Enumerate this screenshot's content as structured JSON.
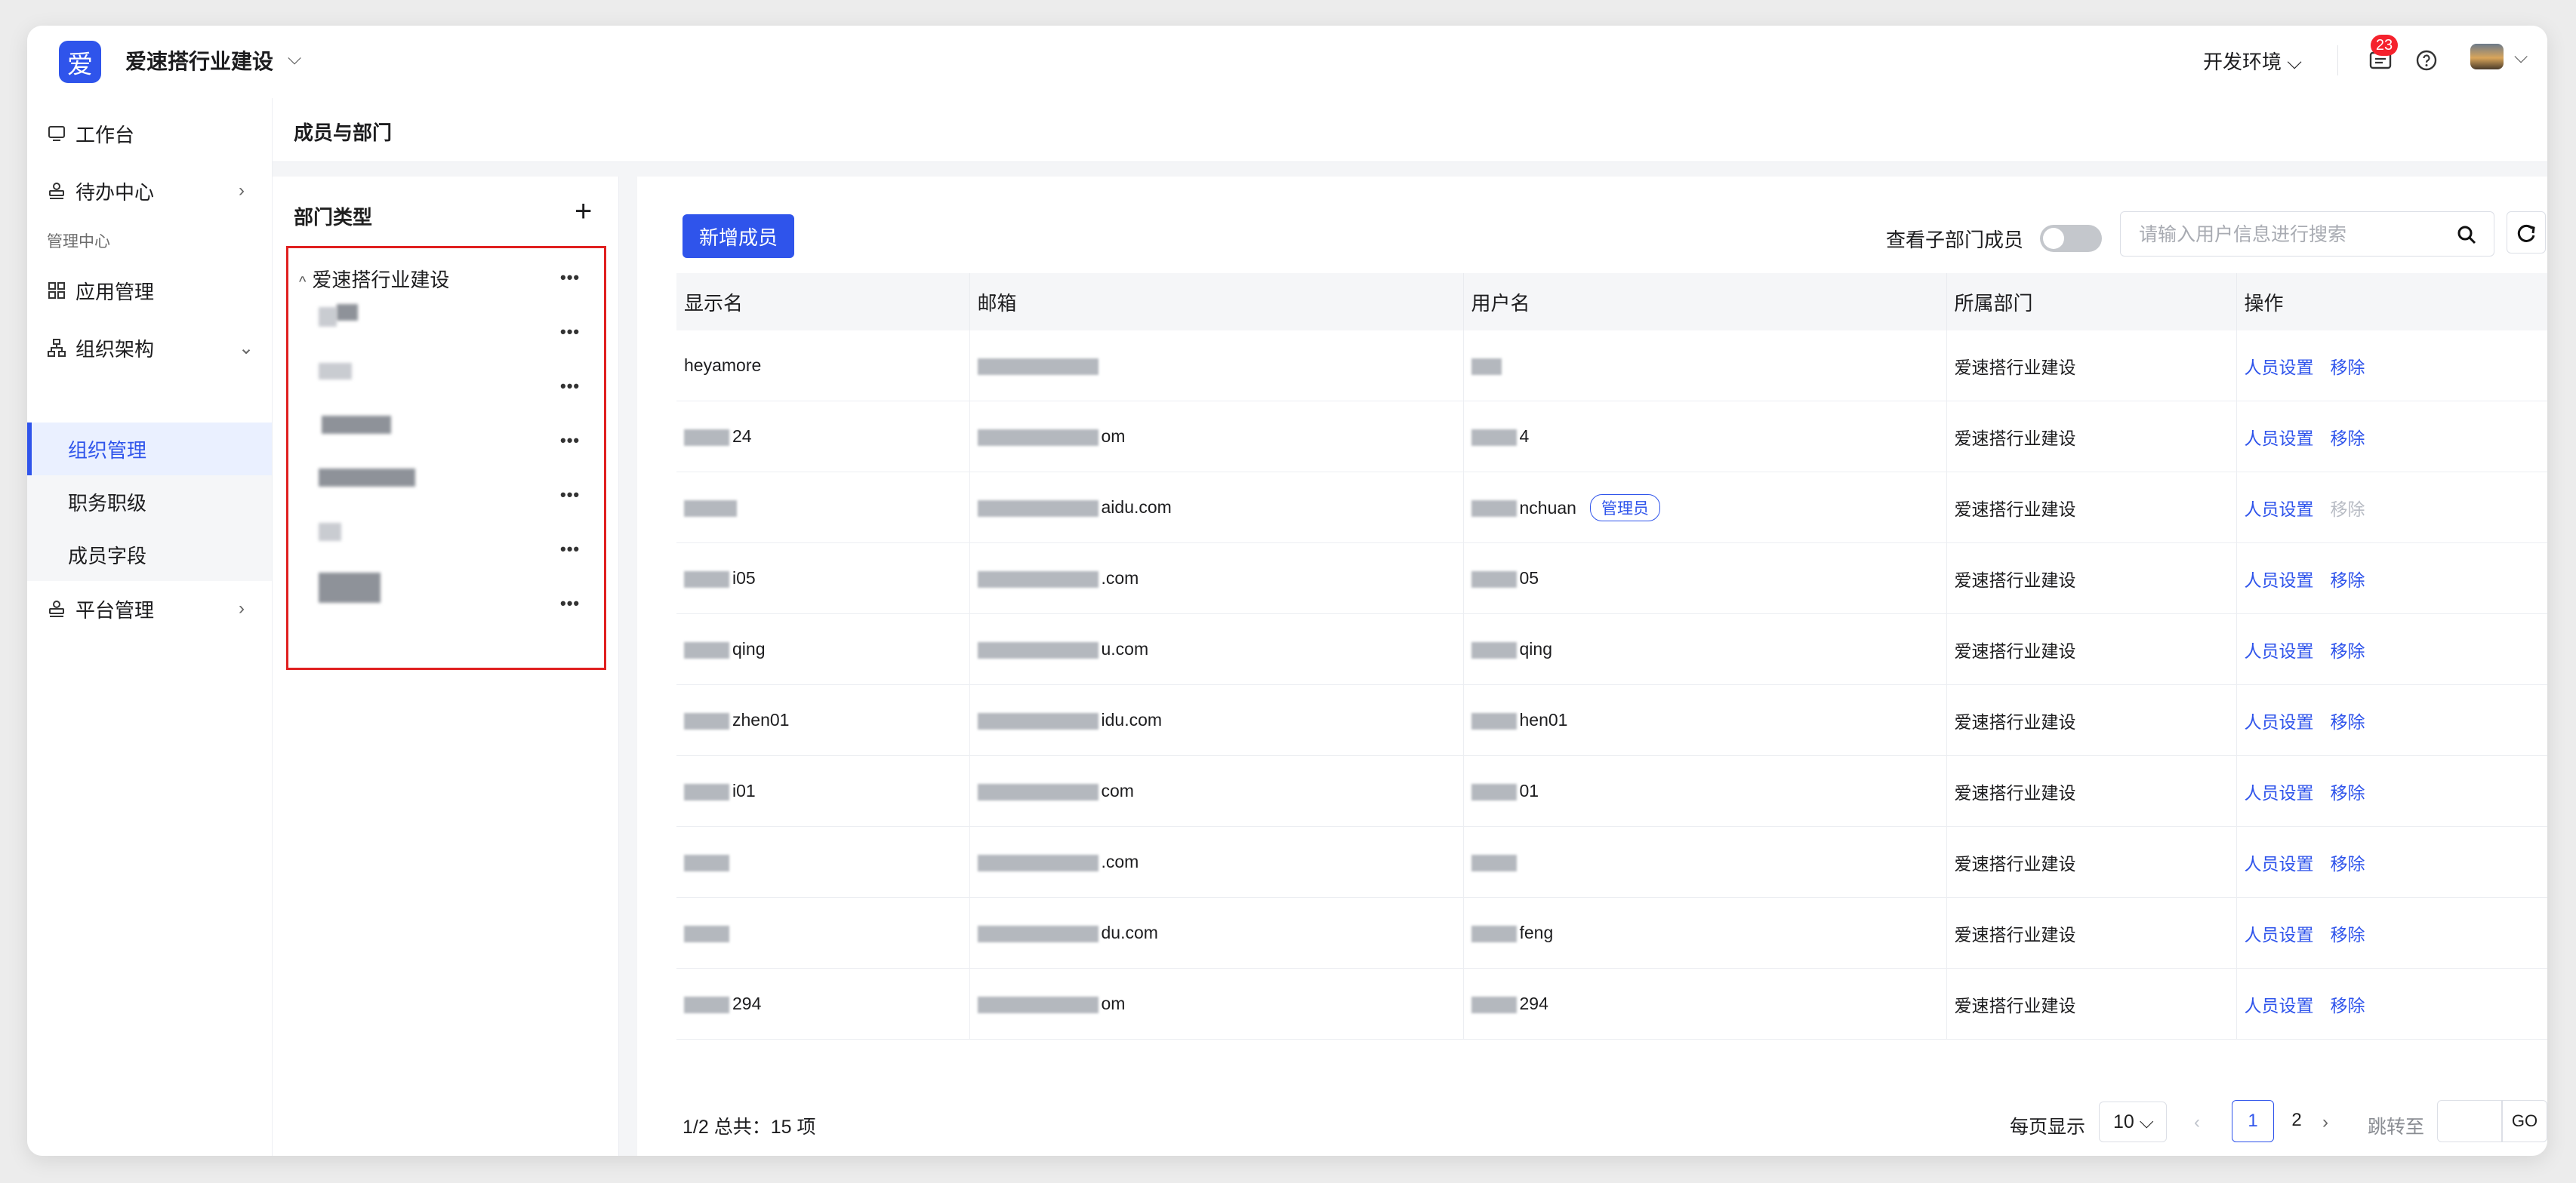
{
  "app": {
    "logo_char": "爱",
    "name": "爱速搭行业建设"
  },
  "topbar": {
    "env_label": "开发环境",
    "message_count": "23"
  },
  "sidebar": {
    "workbench": "工作台",
    "todo": "待办中心",
    "group_label": "管理中心",
    "app_manage": "应用管理",
    "org": "组织架构",
    "org_children": [
      "组织管理",
      "职务职级",
      "成员字段"
    ],
    "platform": "平台管理"
  },
  "page": {
    "title": "成员与部门"
  },
  "dept": {
    "title": "部门类型",
    "root": "爱速搭行业建设",
    "children_count": 6
  },
  "members": {
    "add_button": "新增成员",
    "subdept_label": "查看子部门成员",
    "search_placeholder": "请输入用户信息进行搜索",
    "columns": [
      "显示名",
      "邮箱",
      "用户名",
      "所属部门",
      "操作"
    ],
    "rows": [
      {
        "display": "heyamore",
        "email": "",
        "username": "",
        "dept": "爱速搭行业建设",
        "admin": false,
        "remove_disabled": false
      },
      {
        "display": "24",
        "email": "om",
        "username": "4",
        "dept": "爱速搭行业建设",
        "admin": false,
        "remove_disabled": false
      },
      {
        "display": "",
        "email": "aidu.com",
        "username": "nchuan",
        "dept": "爱速搭行业建设",
        "admin": true,
        "remove_disabled": true
      },
      {
        "display": "i05",
        "email": ".com",
        "username": "05",
        "dept": "爱速搭行业建设",
        "admin": false,
        "remove_disabled": false
      },
      {
        "display": "qing",
        "email": "u.com",
        "username": "qing",
        "dept": "爱速搭行业建设",
        "admin": false,
        "remove_disabled": false
      },
      {
        "display": "zhen01",
        "email": "idu.com",
        "username": "hen01",
        "dept": "爱速搭行业建设",
        "admin": false,
        "remove_disabled": false
      },
      {
        "display": "i01",
        "email": "com",
        "username": "01",
        "dept": "爱速搭行业建设",
        "admin": false,
        "remove_disabled": false
      },
      {
        "display": "",
        "email": ".com",
        "username": "",
        "dept": "爱速搭行业建设",
        "admin": false,
        "remove_disabled": false
      },
      {
        "display": "",
        "email": "du.com",
        "username": "feng",
        "dept": "爱速搭行业建设",
        "admin": false,
        "remove_disabled": false
      },
      {
        "display": "294",
        "email": "om",
        "username": "294",
        "dept": "爱速搭行业建设",
        "admin": false,
        "remove_disabled": false
      }
    ],
    "op_settings": "人员设置",
    "op_remove": "移除",
    "admin_tag": "管理员"
  },
  "pagination": {
    "summary": "1/2 总共：15 项",
    "per_page_label": "每页显示",
    "page_size": "10",
    "pages": [
      "1",
      "2"
    ],
    "current": "1",
    "jump_label": "跳转至",
    "go": "GO"
  },
  "colors": {
    "primary": "#2f54eb",
    "highlight_box": "#e02020",
    "badge": "#f5222d"
  }
}
